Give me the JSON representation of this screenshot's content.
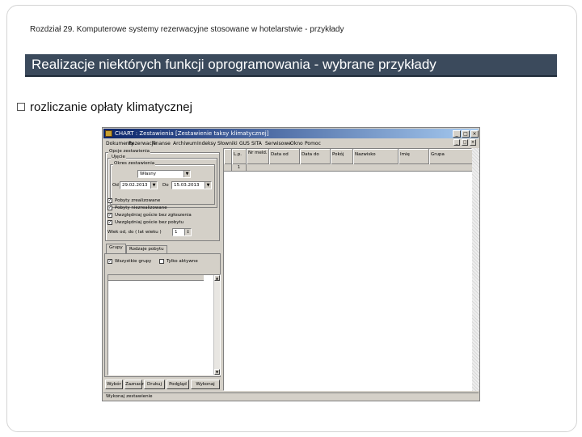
{
  "slide": {
    "chapter": "Rozdział 29. Komputerowe systemy rezerwacyjne stosowane w hotelarstwie - przykłady",
    "title": "Realizacje niektórych funkcji oprogramowania - wybrane przykłady",
    "bullet": "rozliczanie opłaty klimatycznej"
  },
  "app": {
    "title": "CHART : Zestawienia   [Zestawienie taksy klimatycznej]",
    "menu": [
      "Dokumenty",
      "Rezerwacje",
      "Finanse",
      "Archiwum",
      "Indeksy",
      "Słowniki",
      "GUS",
      "SITA",
      "Serwisowe",
      "Okno",
      "Pomoc"
    ],
    "window_buttons": {
      "minimize": "_",
      "maximize": "□",
      "close": "×"
    },
    "left": {
      "group_main": "Opcje zestawienia",
      "group_sub": "Ujęcie",
      "group_range": "Okres zestawienia",
      "range_value": "Własny",
      "from_label": "Od",
      "from_value": "29.02.2013",
      "to_label": "Do",
      "to_value": "15.03.2013",
      "checkboxes": [
        {
          "label": "Pobyty zrealizowane",
          "checked": true
        },
        {
          "label": "Pobyty niezrealizowane",
          "checked": true
        },
        {
          "label": "Uwzględniaj goście bez zgłoszenia",
          "checked": true
        },
        {
          "label": "Uwzględniaj goście bez pobytu",
          "checked": true
        }
      ],
      "age_label": "Wiek od, do ( lat wieku )",
      "age_value": "1",
      "tabs": [
        "Grupy",
        "Rodzaje pobytu"
      ],
      "filter_all": {
        "label": "Wszystkie grupy",
        "checked": true
      },
      "filter_active": {
        "label": "Tylko aktywne",
        "checked": false
      },
      "buttons": [
        "Wybór",
        "Zaznacz",
        "Drukuj",
        "Podgląd",
        "Wykonaj"
      ]
    },
    "grid": {
      "columns": [
        "L.p.",
        "Nr meld.",
        "Data od",
        "Data do",
        "Pokój",
        "Nazwisko",
        "Imię",
        "Grupa"
      ],
      "row_marker": "1"
    },
    "status": "Wykonaj zestawienie"
  }
}
